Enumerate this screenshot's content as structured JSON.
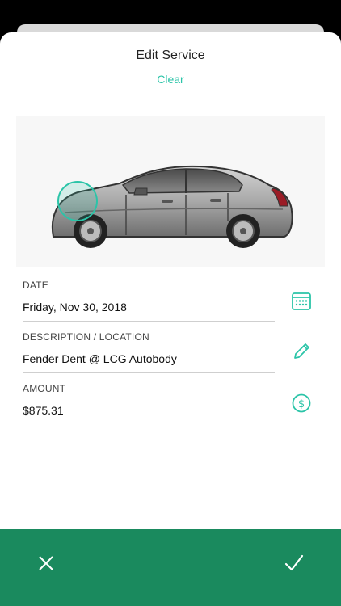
{
  "header": {
    "title": "Edit Service",
    "clear_label": "Clear"
  },
  "fields": {
    "date": {
      "label": "DATE",
      "value": "Friday, Nov 30, 2018",
      "icon": "calendar-icon"
    },
    "description": {
      "label": "DESCRIPTION / LOCATION",
      "value": "Fender Dent @ LCG Autobody",
      "icon": "pencil-icon"
    },
    "amount": {
      "label": "AMOUNT",
      "value": "$875.31",
      "icon": "dollar-icon"
    }
  },
  "footer": {
    "cancel_icon": "close-icon",
    "confirm_icon": "checkmark-icon"
  },
  "colors": {
    "accent": "#2bc4a8",
    "footer": "#1a8a5e"
  }
}
